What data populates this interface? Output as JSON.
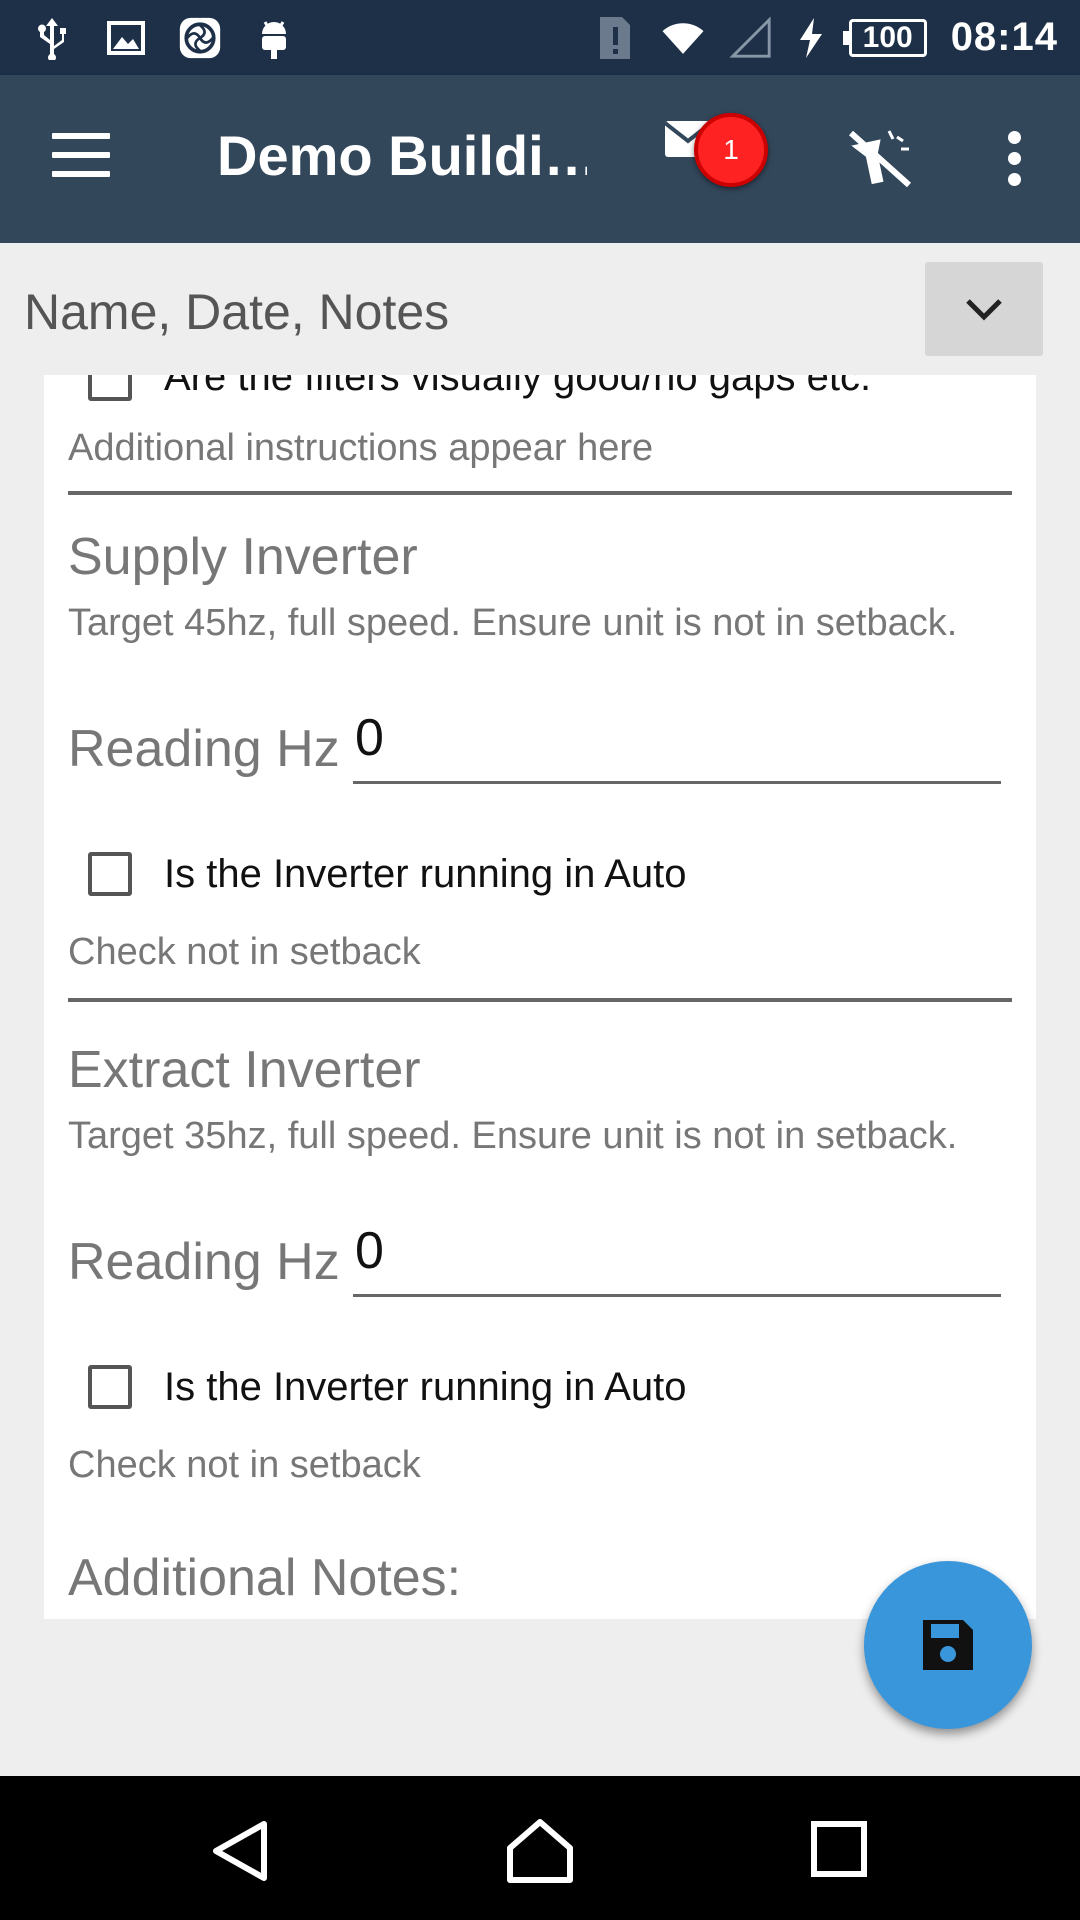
{
  "status_bar": {
    "icons_left": [
      "usb-icon",
      "image-icon",
      "app-icon",
      "android-icon"
    ],
    "icons_right": [
      "alert-sim-icon",
      "wifi-icon",
      "signal-icon",
      "charging-icon"
    ],
    "battery": "100",
    "time": "08:14"
  },
  "app_bar": {
    "title": "Demo Buildi…",
    "mail_badge_count": "1",
    "colors": {
      "background": "#33475b",
      "badge": "#ff2222"
    }
  },
  "section": {
    "label": "Name, Date, Notes"
  },
  "form": {
    "top_checkbox_label": "Are the filters visually good/no gaps etc.",
    "top_instructions": "Additional instructions appear here",
    "items": [
      {
        "heading": "Supply Inverter",
        "description": "Target 45hz, full speed. Ensure unit is not in setback.",
        "reading_label": "Reading Hz",
        "reading_value": "0",
        "checkbox_label": "Is the Inverter running in Auto",
        "instructions": "Check not in setback"
      },
      {
        "heading": "Extract Inverter",
        "description": "Target 35hz, full speed. Ensure unit is not in setback.",
        "reading_label": "Reading Hz",
        "reading_value": "0",
        "checkbox_label": "Is the Inverter running in Auto",
        "instructions": "Check not in setback"
      }
    ],
    "notes_heading": "Additional Notes:"
  },
  "fab": {
    "icon": "save-icon",
    "color": "#3a96db"
  },
  "nav_bar": {
    "buttons": [
      "back-icon",
      "home-icon",
      "recents-icon"
    ]
  }
}
